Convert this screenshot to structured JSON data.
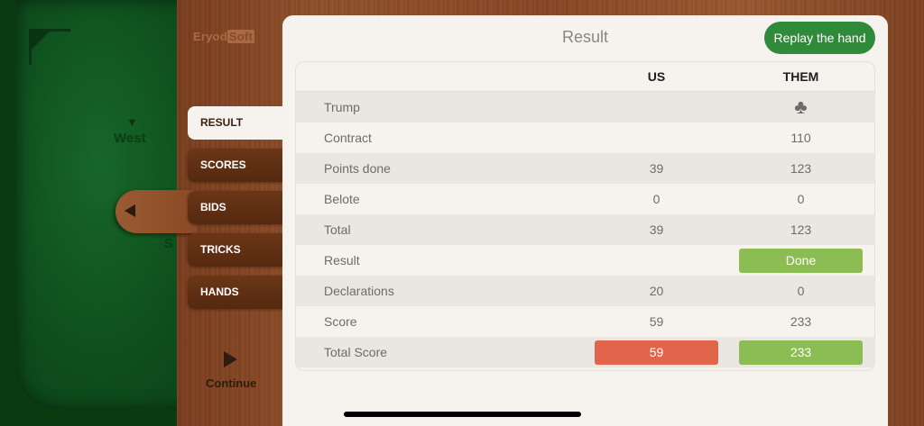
{
  "table_side": {
    "west_label": "West",
    "south_fragment": "S",
    "continue_label": "Continue"
  },
  "brand": {
    "left": "Eryod",
    "right": "Soft"
  },
  "nav": {
    "tabs": [
      {
        "label": "RESULT",
        "active": true
      },
      {
        "label": "SCORES",
        "active": false
      },
      {
        "label": "BIDS",
        "active": false
      },
      {
        "label": "TRICKS",
        "active": false
      },
      {
        "label": "HANDS",
        "active": false
      }
    ]
  },
  "result": {
    "title": "Result",
    "replay_label": "Replay the hand",
    "columns": {
      "us": "US",
      "them": "THEM"
    },
    "rows": [
      {
        "label": "Trump",
        "us": "",
        "them": "♣",
        "them_icon": "club-icon"
      },
      {
        "label": "Contract",
        "us": "",
        "them": "110"
      },
      {
        "label": "Points done",
        "us": "39",
        "them": "123"
      },
      {
        "label": "Belote",
        "us": "0",
        "them": "0"
      },
      {
        "label": "Total",
        "us": "39",
        "them": "123"
      },
      {
        "label": "Result",
        "us": "",
        "them": "Done",
        "them_badge": "green"
      },
      {
        "label": "Declarations",
        "us": "20",
        "them": "0"
      },
      {
        "label": "Score",
        "us": "59",
        "them": "233"
      },
      {
        "label": "Total Score",
        "us": "59",
        "them": "233",
        "us_badge": "red",
        "them_badge": "green"
      }
    ]
  },
  "colors": {
    "accent_green": "#2f8a3a",
    "badge_green": "#8bbd54",
    "badge_red": "#e0654a",
    "felt_green": "#17662a",
    "wood": "#8a4624"
  }
}
